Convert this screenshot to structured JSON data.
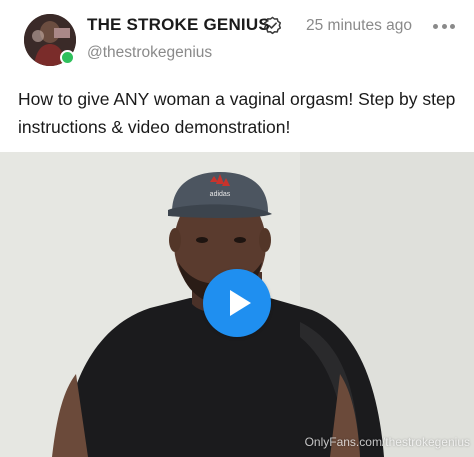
{
  "post": {
    "author_name": "THE STROKE GENIUS",
    "author_handle": "@thestrokegenius",
    "timestamp": "25 minutes ago",
    "caption": "How to give ANY woman a vaginal orgasm! Step by step instructions & video demonstration!",
    "verified": true,
    "online": true,
    "more_icon": "more-horizontal-icon"
  },
  "video": {
    "watermark": "OnlyFans.com/thestrokegenius",
    "cap_logo_text": "adidas",
    "play_button_color": "#1f8ff0"
  },
  "colors": {
    "online_dot": "#2fc05c",
    "muted_text": "#8a8a8a",
    "play_button": "#1f8ff0"
  }
}
